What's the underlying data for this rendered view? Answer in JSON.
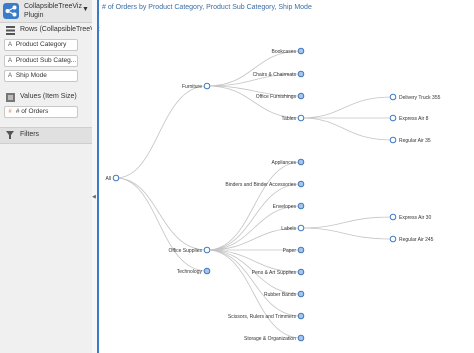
{
  "sidebar": {
    "plugin_name_line1": "CollapsibleTreeViz",
    "plugin_name_line2": "Plugin",
    "rows_label": "Rows (CollapsibleTreeViz",
    "rows": [
      {
        "label": "Product Category",
        "tag": "A"
      },
      {
        "label": "Product Sub Categ...",
        "tag": "A"
      },
      {
        "label": "Ship Mode",
        "tag": "A"
      }
    ],
    "values_label": "Values (Item Size)",
    "values": [
      {
        "label": "# of Orders",
        "tag": "#"
      }
    ],
    "filters_label": "Filters"
  },
  "viz": {
    "title": "# of Orders by Product Category, Product Sub Category, Ship Mode"
  },
  "tree": {
    "root": "All",
    "categories": [
      "Furniture",
      "Office Supplies",
      "Technology"
    ],
    "furniture_children": [
      "Bookcases",
      "Chairs & Chairmats",
      "Office Furnishings",
      "Tables"
    ],
    "tables_children": [
      "Delivery Truck  355",
      "Express Air  8",
      "Regular Air  35"
    ],
    "office_children": [
      "Appliances",
      "Binders and Binder Accessories",
      "Envelopes",
      "Labels",
      "Paper",
      "Pens & Art Supplies",
      "Rubber Bands",
      "Scissors, Rulers and Trimmers",
      "Storage & Organization"
    ],
    "labels_children": [
      "Express Air  30",
      "Regular Air  245"
    ]
  },
  "colors": {
    "accent": "#3a7cc7",
    "node_stroke": "#3b78c2",
    "collapsed_fill": "#a9c4e4",
    "title": "#3a6ea5"
  },
  "icons": [
    "tree-logo-icon",
    "dropdown-caret-icon",
    "grid-icon",
    "values-icon",
    "filter-icon",
    "collapse-arrow-icon"
  ]
}
